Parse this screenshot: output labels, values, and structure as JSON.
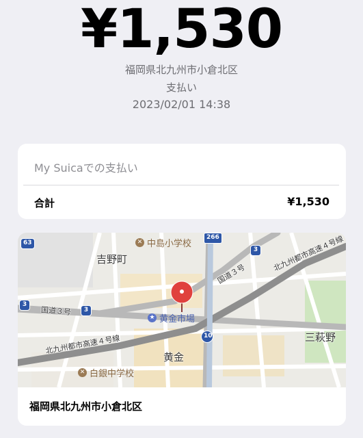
{
  "transaction": {
    "amount": "¥1,530",
    "location": "福岡県北九州市小倉北区",
    "type": "支払い",
    "datetime": "2023/02/01 14:38"
  },
  "summary": {
    "caption": "My Suicaでの支払い",
    "total_label": "合計",
    "total_value": "¥1,530"
  },
  "map": {
    "pois": {
      "school1": "中島小学校",
      "school2": "白銀中学校",
      "market": "黄金市場"
    },
    "areas": {
      "a1": "吉野町",
      "a2": "黄金",
      "a3": "三萩野"
    },
    "roads": {
      "r1": "国道３号",
      "r2": "国道３号",
      "r3": "北九州都市高速４号線",
      "r4": "北九州都市高速４号線"
    },
    "shields": {
      "s63": "63",
      "s266": "266",
      "s3a": "3",
      "s3b": "3",
      "s3c": "3",
      "s10": "10"
    },
    "address": "福岡県北九州市小倉北区",
    "pin_color": "#e0413d"
  }
}
